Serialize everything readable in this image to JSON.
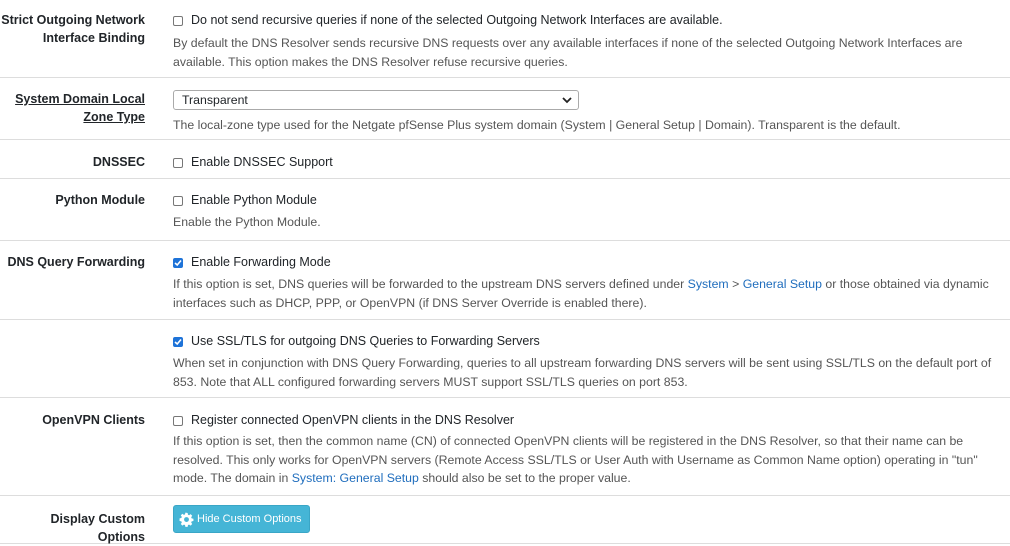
{
  "strict_binding": {
    "label": "Strict Outgoing Network Interface Binding",
    "checkbox_label": "Do not send recursive queries if none of the selected Outgoing Network Interfaces are available.",
    "checked": false,
    "help": "By default the DNS Resolver sends recursive DNS requests over any available interfaces if none of the selected Outgoing Network Interfaces are available. This option makes the DNS Resolver refuse recursive queries."
  },
  "zone_type": {
    "label": "System Domain Local Zone Type",
    "selected": "Transparent",
    "help": "The local-zone type used for the Netgate pfSense Plus system domain (System | General Setup | Domain). Transparent is the default."
  },
  "dnssec": {
    "label": "DNSSEC",
    "checkbox_label": "Enable DNSSEC Support",
    "checked": false
  },
  "python_module": {
    "label": "Python Module",
    "checkbox_label": "Enable Python Module",
    "checked": false,
    "help": "Enable the Python Module."
  },
  "forwarding": {
    "label": "DNS Query Forwarding",
    "checkbox_label": "Enable Forwarding Mode",
    "checked": true,
    "help_before": "If this option is set, DNS queries will be forwarded to the upstream DNS servers defined under ",
    "help_link1": "System",
    "help_sep": " > ",
    "help_link2": "General Setup",
    "help_after": " or those obtained via dynamic interfaces such as DHCP, PPP, or OpenVPN (if DNS Server Override is enabled there)."
  },
  "ssl_tls": {
    "checkbox_label": "Use SSL/TLS for outgoing DNS Queries to Forwarding Servers",
    "checked": true,
    "help": "When set in conjunction with DNS Query Forwarding, queries to all upstream forwarding DNS servers will be sent using SSL/TLS on the default port of 853. Note that ALL configured forwarding servers MUST support SSL/TLS queries on port 853."
  },
  "openvpn": {
    "label": "OpenVPN Clients",
    "checkbox_label": "Register connected OpenVPN clients in the DNS Resolver",
    "checked": false,
    "help_before": "If this option is set, then the common name (CN) of connected OpenVPN clients will be registered in the DNS Resolver, so that their name can be resolved. This only works for OpenVPN servers (Remote Access SSL/TLS or User Auth with Username as Common Name option) operating in \"tun\" mode. The domain in ",
    "help_link": "System: General Setup",
    "help_after": " should also be set to the proper value."
  },
  "custom_options": {
    "label": "Display Custom Options",
    "button_label": "Hide Custom Options",
    "button_color": "#45b5d6"
  }
}
